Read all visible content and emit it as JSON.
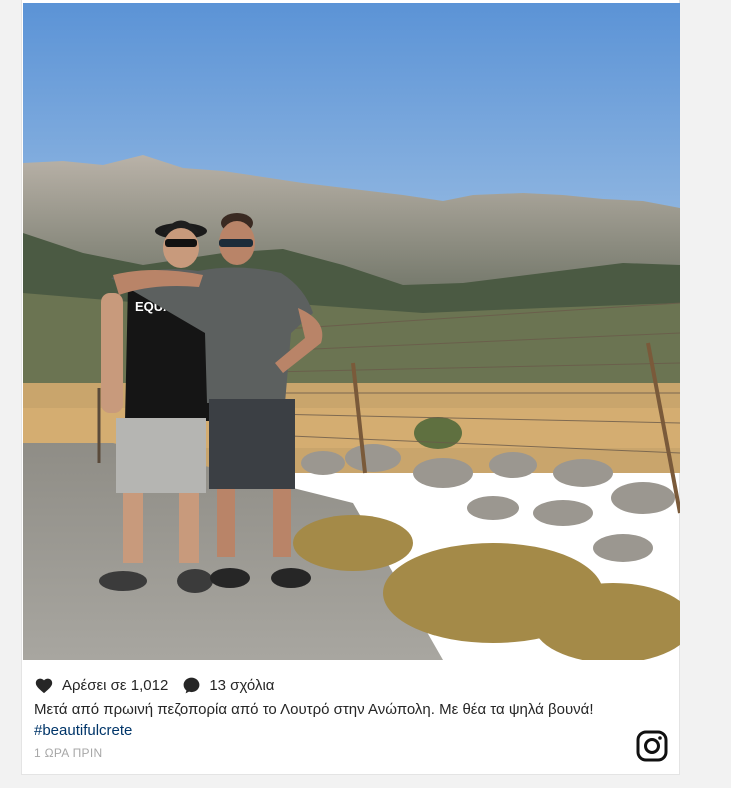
{
  "post": {
    "likes_label": "Αρέσει σε 1,012",
    "comments_label": "13 σχόλια",
    "caption_text": "Μετά από πρωινή πεζοπορία από το Λουτρό στην Ανώπολη. Με θέα τα ψηλά βουνά! ",
    "hashtag": "#beautifulcrete",
    "timestamp": "1 ΩΡΑ ΠΡΙΝ",
    "shirt_text": "EQUALITY"
  },
  "icons": {
    "like": "heart-icon",
    "comment": "comment-bubble-icon",
    "brand": "instagram-icon"
  },
  "colors": {
    "sky": "#6fa0da",
    "text": "#262626",
    "hashtag": "#003569",
    "timestamp": "#a7a7a7"
  }
}
